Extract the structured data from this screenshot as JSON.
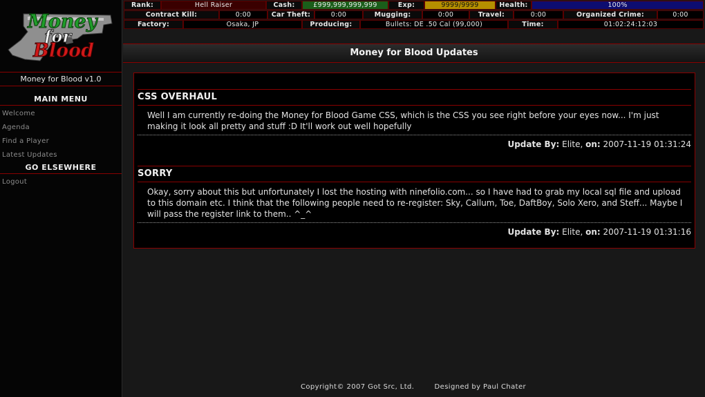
{
  "sidebar": {
    "logo_text": [
      "Money",
      "for",
      "Blood"
    ],
    "version": "Money for Blood v1.0",
    "main_menu_heading": "MAIN MENU",
    "main_menu_items": [
      {
        "label": "Welcome"
      },
      {
        "label": "Agenda"
      },
      {
        "label": "Find a Player"
      },
      {
        "label": "Latest Updates"
      }
    ],
    "elsewhere_heading": "GO ELSEWHERE",
    "elsewhere_items": [
      {
        "label": "Logout"
      }
    ]
  },
  "stats": {
    "rank_label": "Rank:",
    "rank": "Hell Raiser",
    "cash_label": "Cash:",
    "cash": "£999,999,999,999",
    "exp_label": "Exp:",
    "exp": "9999/9999",
    "health_label": "Health:",
    "health": "100%",
    "health_fraction": 1.0,
    "contract_kill_label": "Contract Kill:",
    "contract_kill": "0:00",
    "car_theft_label": "Car Theft:",
    "car_theft": "0:00",
    "mugging_label": "Mugging:",
    "mugging": "0:00",
    "travel_label": "Travel:",
    "travel": "0:00",
    "organized_crime_label": "Organized Crime:",
    "organized_crime": "0:00",
    "factory_label": "Factory:",
    "factory": "Osaka, JP",
    "producing_label": "Producing:",
    "producing": "Bullets: DE .50 Cal (99,000)",
    "time_label": "Time:",
    "time": "01:02:24:12:03"
  },
  "page": {
    "title": "Money for Blood Updates"
  },
  "updates": [
    {
      "title": "CSS OVERHAUL",
      "body": "Well I am currently re-doing the Money for Blood Game CSS, which is the CSS you see right before your eyes now... I'm just making it look all pretty and stuff :D It'll work out well hopefully",
      "by_label": "Update By:",
      "author": "Elite,",
      "on_label": "on:",
      "date": "2007-11-19 01:31:24"
    },
    {
      "title": "SORRY",
      "body": "Okay, sorry about this but unfortunately I lost the hosting with ninefolio.com... so I have had to grab my local sql file and upload to this domain etc. I think that the following people need to re-register: Sky, Callum, Toe, DaftBoy, Solo Xero, and Steff... Maybe I will pass the register link to them.. ^_^",
      "by_label": "Update By:",
      "author": "Elite,",
      "on_label": "on:",
      "date": "2007-11-19 01:31:16"
    }
  ],
  "footer": {
    "copyright": "Copyright© 2007 Got Src, Ltd.",
    "designer": "Designed by Paul Chater"
  },
  "colors": {
    "accent_red": "#8a0000",
    "cash_green": "#1a5e1a",
    "exp_gold": "#b58f00",
    "health_blue": "#0d0d70",
    "rank_red": "#3a0000"
  }
}
